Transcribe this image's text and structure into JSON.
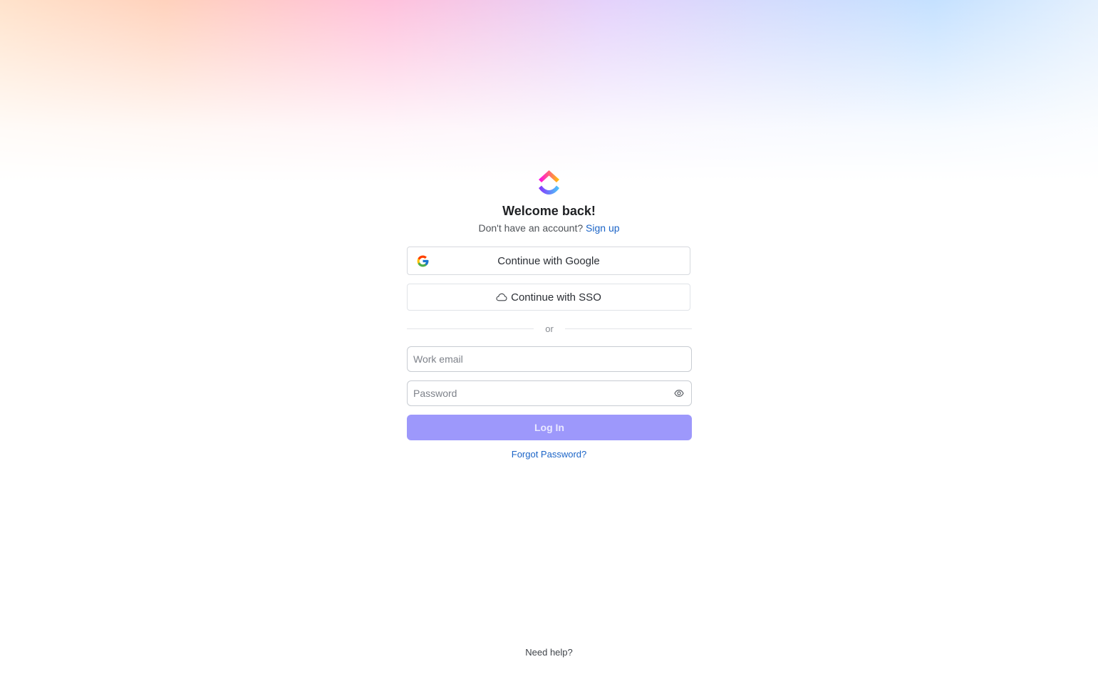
{
  "header": {
    "title": "Welcome back!",
    "no_account_text": "Don't have an account?",
    "signup_link": "Sign up"
  },
  "auth": {
    "google_label": "Continue with Google",
    "sso_label": "Continue with SSO",
    "divider_text": "or"
  },
  "form": {
    "email_placeholder": "Work email",
    "email_value": "",
    "password_placeholder": "Password",
    "password_value": "",
    "login_label": "Log In",
    "forgot_label": "Forgot Password?"
  },
  "footer": {
    "help_label": "Need help?"
  },
  "colors": {
    "link": "#1b64c7",
    "login_button": "#9d98fb"
  },
  "icons": {
    "logo": "clickup-logo",
    "google": "google-icon",
    "sso": "cloud-icon",
    "password_toggle": "eye-icon"
  }
}
